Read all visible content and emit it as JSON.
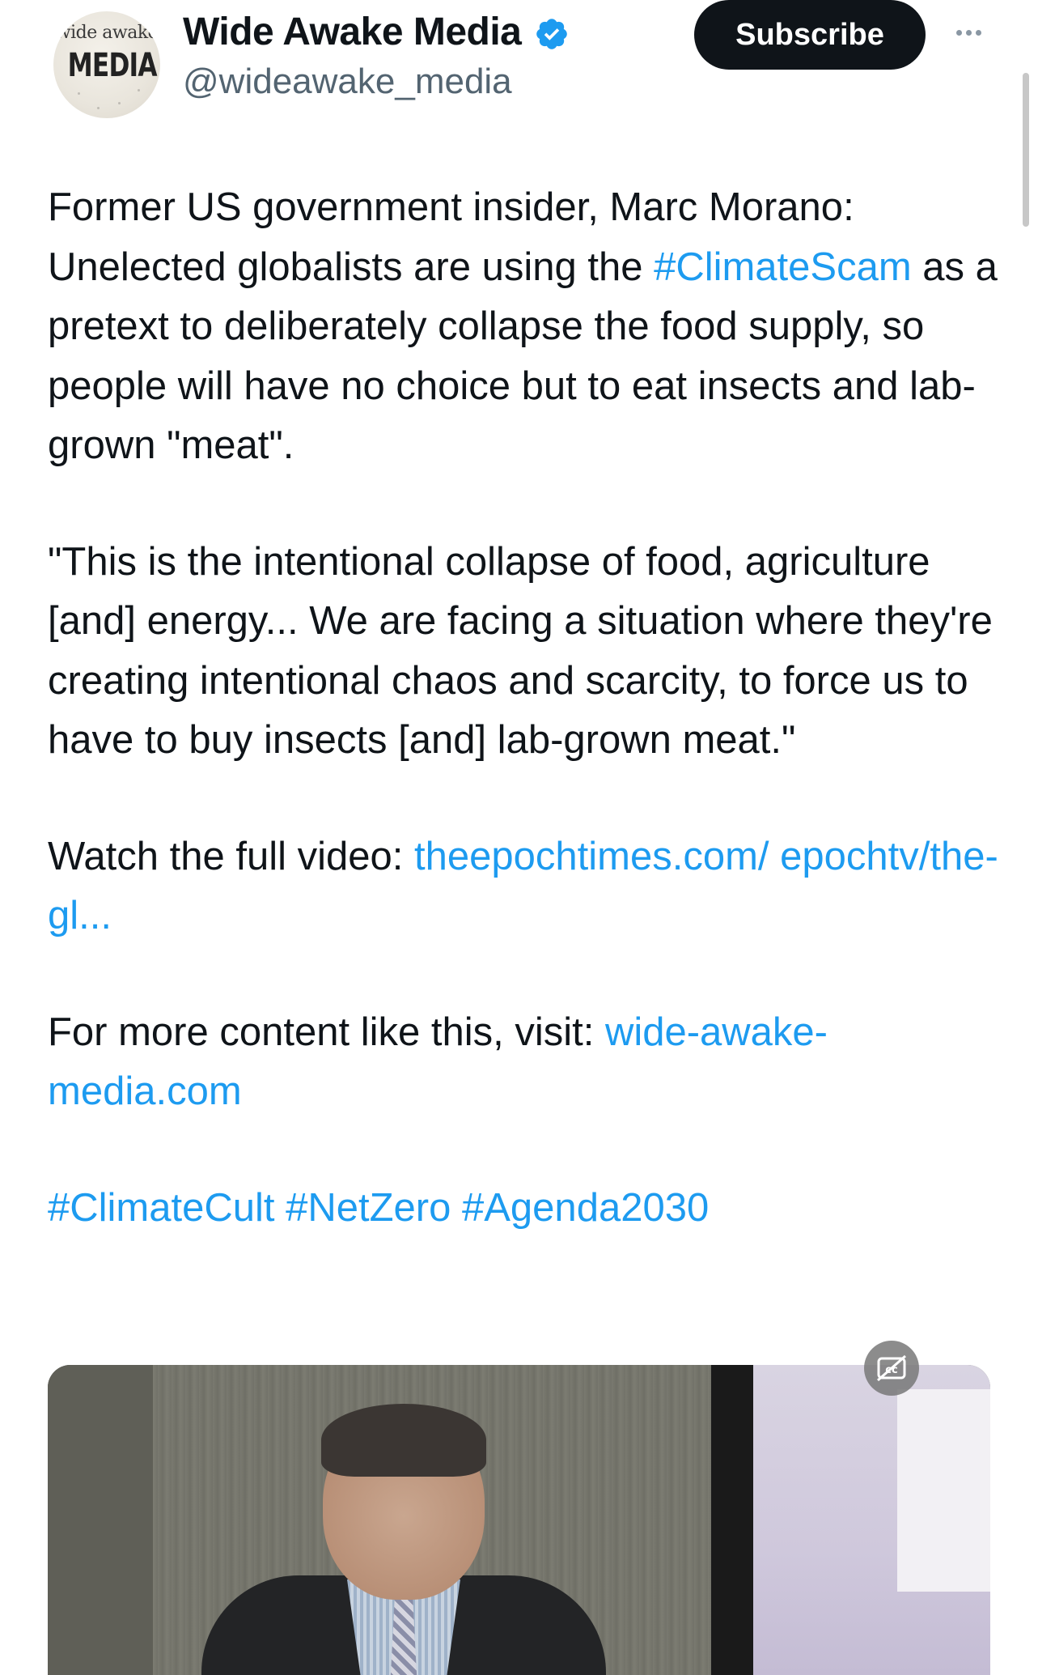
{
  "header": {
    "avatar_text_top": "wide awake",
    "avatar_text_bottom": "MEDIA",
    "display_name": "Wide Awake Media",
    "handle": "@wideawake_media",
    "subscribe_label": "Subscribe",
    "verified_icon": "verified-badge-icon",
    "more_icon": "more-options-icon"
  },
  "tweet": {
    "p1_text": "Former US government insider, Marc Morano: Unelected globalists are using the ",
    "p1_hashtag": "#ClimateScam",
    "p1_rest": " as a pretext to deliberately collapse the food supply, so people will have no choice but to eat insects and lab-grown \"meat\".",
    "p2_text": "\"This is the intentional collapse of food, agriculture [and] energy... We are facing a situation where they're creating intentional chaos and scarcity, to force us to have to buy insects [and] lab-grown meat.\"",
    "p3_text": "Watch the full video: ",
    "p3_link": "theepochtimes.com/ epochtv/the-gl...",
    "p4_text": "For more content like this, visit: ",
    "p4_link": "wide-awake- media.com",
    "hashtags": [
      "#ClimateCult",
      "#NetZero",
      "#Agenda2030"
    ]
  },
  "media": {
    "cc_icon": "closed-captions-off-icon"
  },
  "colors": {
    "link": "#1d9bf0",
    "text": "#0f1419",
    "secondary": "#536471",
    "button_bg": "#0f1419",
    "verified": "#1d9bf0"
  }
}
